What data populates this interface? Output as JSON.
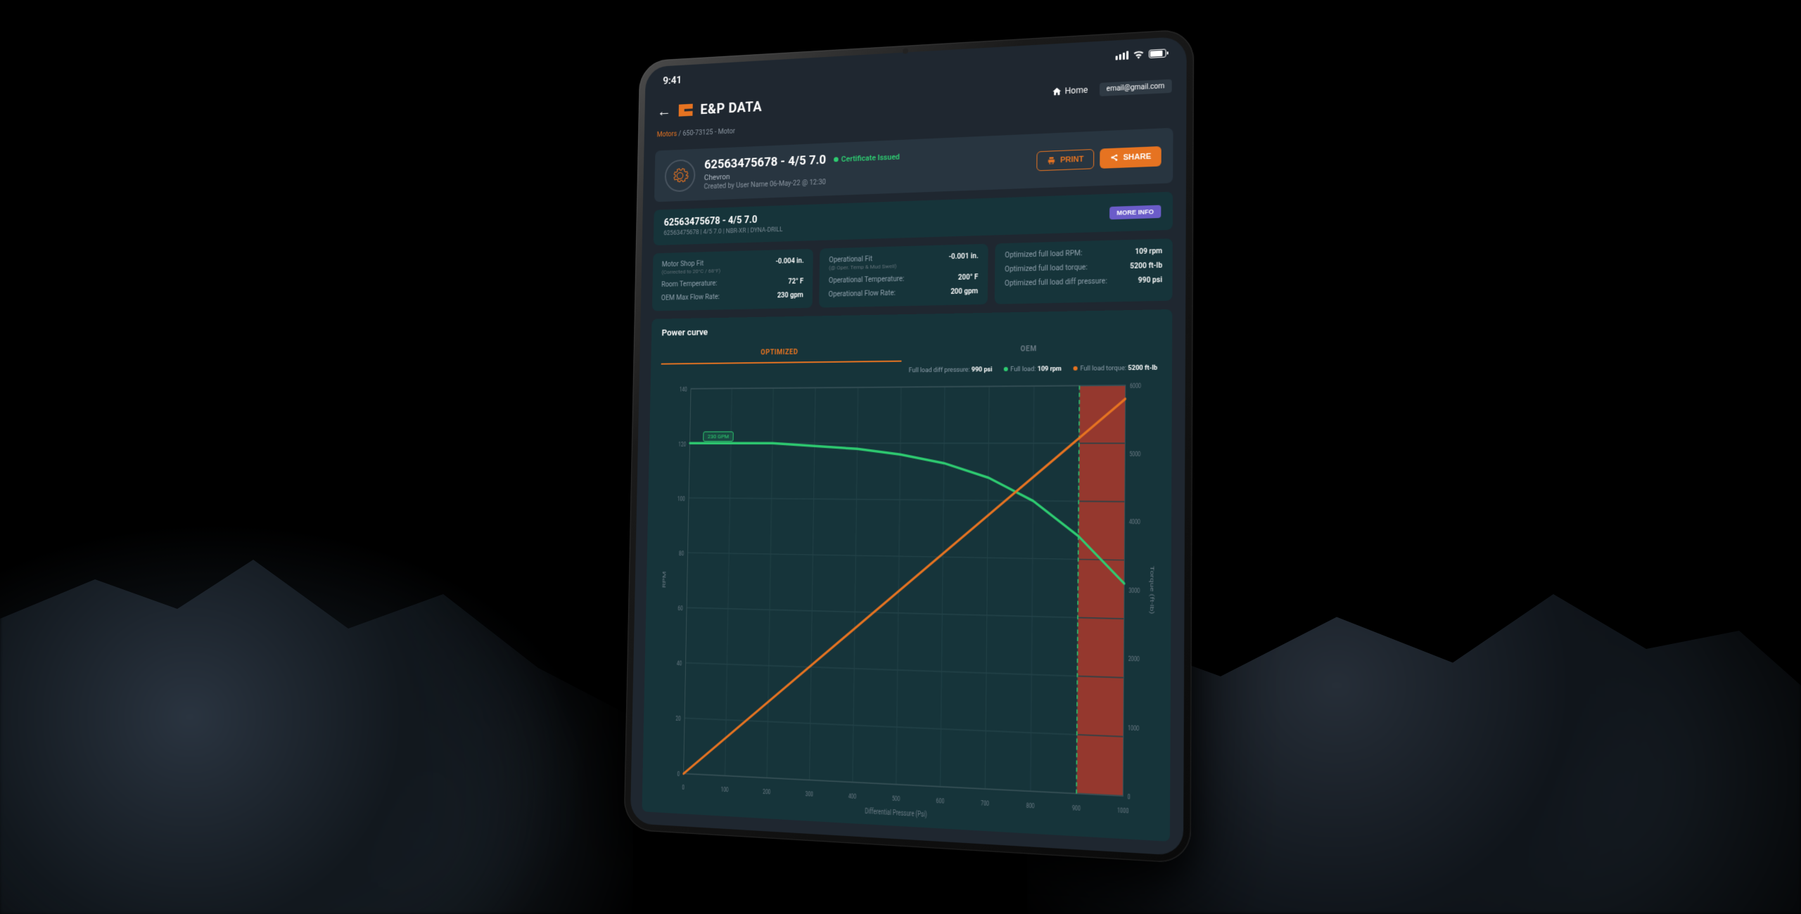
{
  "status_bar": {
    "time": "9:41"
  },
  "header": {
    "app_title": "E&P DATA",
    "home_label": "Home",
    "user_email": "email@gmail.com"
  },
  "breadcrumb": {
    "root": "Motors",
    "sep": "/",
    "current": "650-73125 - Motor"
  },
  "title_card": {
    "title": "62563475678 - 4/5 7.0",
    "cert": "Certificate Issued",
    "company": "Chevron",
    "created": "Created by User Name 06-May-22 @ 12:30",
    "print": "PRINT",
    "share": "SHARE"
  },
  "info_header": {
    "title": "62563475678 - 4/5 7.0",
    "sub": "62563475678 | 4/5 7.0 | NBR-XR | DYNA-DRILL",
    "more": "MORE INFO"
  },
  "stats": {
    "col1": [
      {
        "label": "Motor Shop Fit",
        "sublabel": "(Corrected to 20°C / 68°F)",
        "value": "-0.004 in."
      },
      {
        "label": "Room Temperature:",
        "value": "72° F"
      },
      {
        "label": "OEM Max Flow Rate:",
        "value": "230 gpm"
      }
    ],
    "col2": [
      {
        "label": "Operational Fit",
        "sublabel": "(@ Oper. Temp & Mud Swell)",
        "value": "-0.001 in."
      },
      {
        "label": "Operational Temperature:",
        "value": "200° F"
      },
      {
        "label": "Operational Flow Rate:",
        "value": "200 gpm"
      }
    ],
    "col3": [
      {
        "label": "Optimized full load RPM:",
        "value": "109 rpm"
      },
      {
        "label": "Optimized full load torque:",
        "value": "5200 ft-lb"
      },
      {
        "label": "Optimized full load diff pressure:",
        "value": "990 psi"
      }
    ]
  },
  "chart": {
    "title": "Power curve",
    "tab_optimized": "OPTIMIZED",
    "tab_oem": "OEM",
    "legend": {
      "diff_label": "Full load diff pressure:",
      "diff_value": "990 psi",
      "rpm_label": "Full load:",
      "rpm_value": "109 rpm",
      "torque_label": "Full load torque:",
      "torque_value": "5200 ft-lb"
    },
    "xlabel": "Differential Pressure (Psi)",
    "ylabel_left": "RPM",
    "ylabel_right": "Torque (ft-lb)",
    "flow_tag": "230 GPM"
  },
  "chart_data": {
    "type": "line",
    "xlabel": "Differential Pressure (Psi)",
    "x_ticks": [
      0,
      100,
      200,
      300,
      400,
      500,
      600,
      700,
      800,
      900,
      1000
    ],
    "left_axis": {
      "label": "RPM",
      "ticks": [
        0,
        20,
        40,
        60,
        80,
        100,
        120,
        140
      ]
    },
    "right_axis": {
      "label": "Torque (ft-lb)",
      "ticks": [
        0,
        1000,
        2000,
        3000,
        4000,
        5000,
        6000
      ]
    },
    "full_load_line_x": 900,
    "stall_region_x": [
      900,
      1000
    ],
    "series": [
      {
        "name": "RPM @ 230 GPM",
        "color": "#2ecc71",
        "axis": "left",
        "x": [
          0,
          100,
          200,
          300,
          400,
          500,
          600,
          700,
          800,
          900,
          1000
        ],
        "values": [
          120,
          120,
          120,
          119,
          118,
          116,
          113,
          108,
          100,
          88,
          72
        ]
      },
      {
        "name": "Torque",
        "color": "#e67321",
        "axis": "right",
        "x": [
          0,
          1000
        ],
        "values": [
          0,
          5800
        ]
      }
    ]
  }
}
